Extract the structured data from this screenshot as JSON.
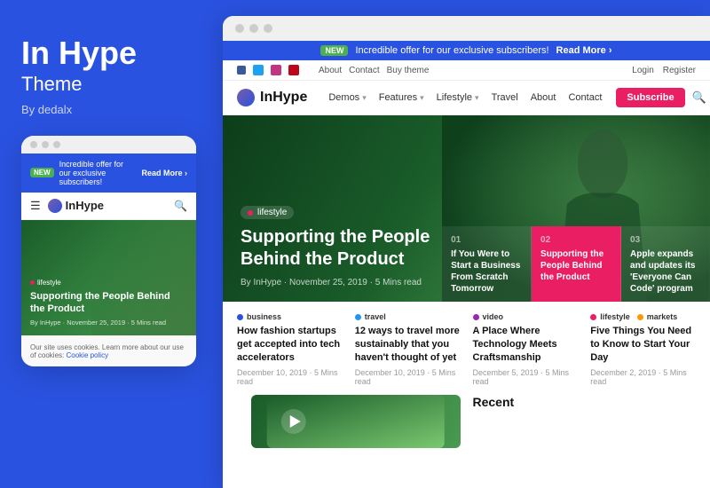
{
  "left": {
    "title": "In Hype",
    "subtitle": "Theme",
    "author": "By dedalx",
    "mobile": {
      "banner": {
        "badge": "NEW",
        "text": "Incredible offer for our exclusive subscribers!",
        "link": "Read More ›"
      },
      "nav": {
        "logo": "InHype"
      },
      "hero": {
        "tag": "lifestyle",
        "title": "Supporting the People Behind the Product",
        "meta": "By InHype · November 25, 2019 · 5 Mins read"
      },
      "cookie": "Our site uses cookies. Learn more about our use of cookies:",
      "cookie_link": "Cookie policy"
    }
  },
  "right": {
    "titlebar_dots": [
      "dot1",
      "dot2",
      "dot3"
    ],
    "top_banner": {
      "badge": "NEW",
      "text": "Incredible offer for our exclusive subscribers!",
      "link": "Read More ›"
    },
    "secondary_nav": {
      "links": [
        "About",
        "Contact",
        "Buy theme"
      ],
      "right_links": [
        "Login",
        "Register"
      ]
    },
    "main_nav": {
      "logo": "InHype",
      "links": [
        "Demos",
        "Features",
        "Lifestyle",
        "Travel",
        "About",
        "Contact"
      ],
      "subscribe": "Subscribe"
    },
    "hero": {
      "tag": "lifestyle",
      "title": "Supporting the People Behind the Product",
      "meta": "By InHype · November 25, 2019 · 5 Mins read"
    },
    "article_cards": [
      {
        "number": "01",
        "title": "If You Were to Start a Business From Scratch Tomorrow"
      },
      {
        "number": "02",
        "title": "Supporting the People Behind the Product",
        "highlighted": true
      },
      {
        "number": "03",
        "title": "Apple expands and updates its 'Everyone Can Code' program"
      }
    ],
    "articles": [
      {
        "category": "business",
        "cat_color": "#2952e0",
        "title": "How fashion startups get accepted into tech accelerators",
        "meta": "December 10, 2019 · 5 Mins read"
      },
      {
        "category": "travel",
        "cat_color": "#2196f3",
        "title": "12 ways to travel more sustainably that you haven't thought of yet",
        "meta": "December 10, 2019 · 5 Mins read"
      },
      {
        "category": "video",
        "cat_color": "#9c27b0",
        "title": "A Place Where Technology Meets Craftsmanship",
        "meta": "December 5, 2019 · 5 Mins read"
      },
      {
        "category": "lifestyle",
        "cat_color": "#e91e63",
        "cat_color2": "#ff9800",
        "second_category": "markets",
        "title": "Five Things You Need to Know to Start Your Day",
        "meta": "December 2, 2019 · 5 Mins read"
      }
    ],
    "recent_label": "Recent"
  }
}
